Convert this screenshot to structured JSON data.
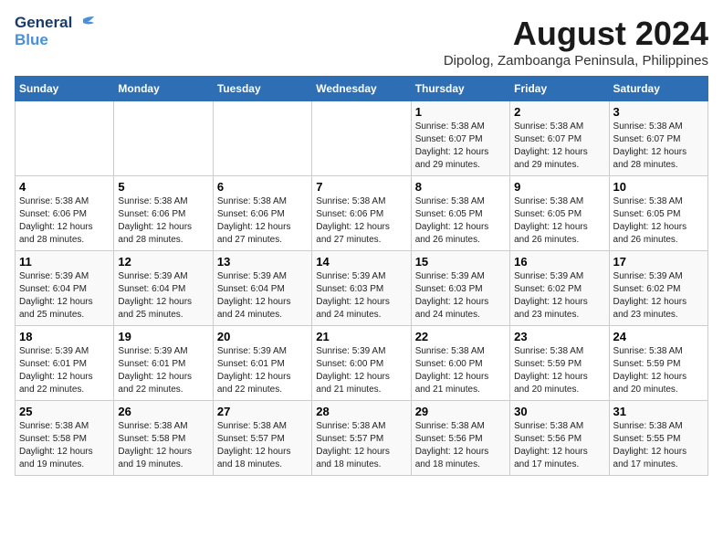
{
  "logo": {
    "line1": "General",
    "line2": "Blue"
  },
  "title": "August 2024",
  "subtitle": "Dipolog, Zamboanga Peninsula, Philippines",
  "headers": [
    "Sunday",
    "Monday",
    "Tuesday",
    "Wednesday",
    "Thursday",
    "Friday",
    "Saturday"
  ],
  "weeks": [
    [
      {
        "day": "",
        "info": ""
      },
      {
        "day": "",
        "info": ""
      },
      {
        "day": "",
        "info": ""
      },
      {
        "day": "",
        "info": ""
      },
      {
        "day": "1",
        "info": "Sunrise: 5:38 AM\nSunset: 6:07 PM\nDaylight: 12 hours\nand 29 minutes."
      },
      {
        "day": "2",
        "info": "Sunrise: 5:38 AM\nSunset: 6:07 PM\nDaylight: 12 hours\nand 29 minutes."
      },
      {
        "day": "3",
        "info": "Sunrise: 5:38 AM\nSunset: 6:07 PM\nDaylight: 12 hours\nand 28 minutes."
      }
    ],
    [
      {
        "day": "4",
        "info": "Sunrise: 5:38 AM\nSunset: 6:06 PM\nDaylight: 12 hours\nand 28 minutes."
      },
      {
        "day": "5",
        "info": "Sunrise: 5:38 AM\nSunset: 6:06 PM\nDaylight: 12 hours\nand 28 minutes."
      },
      {
        "day": "6",
        "info": "Sunrise: 5:38 AM\nSunset: 6:06 PM\nDaylight: 12 hours\nand 27 minutes."
      },
      {
        "day": "7",
        "info": "Sunrise: 5:38 AM\nSunset: 6:06 PM\nDaylight: 12 hours\nand 27 minutes."
      },
      {
        "day": "8",
        "info": "Sunrise: 5:38 AM\nSunset: 6:05 PM\nDaylight: 12 hours\nand 26 minutes."
      },
      {
        "day": "9",
        "info": "Sunrise: 5:38 AM\nSunset: 6:05 PM\nDaylight: 12 hours\nand 26 minutes."
      },
      {
        "day": "10",
        "info": "Sunrise: 5:38 AM\nSunset: 6:05 PM\nDaylight: 12 hours\nand 26 minutes."
      }
    ],
    [
      {
        "day": "11",
        "info": "Sunrise: 5:39 AM\nSunset: 6:04 PM\nDaylight: 12 hours\nand 25 minutes."
      },
      {
        "day": "12",
        "info": "Sunrise: 5:39 AM\nSunset: 6:04 PM\nDaylight: 12 hours\nand 25 minutes."
      },
      {
        "day": "13",
        "info": "Sunrise: 5:39 AM\nSunset: 6:04 PM\nDaylight: 12 hours\nand 24 minutes."
      },
      {
        "day": "14",
        "info": "Sunrise: 5:39 AM\nSunset: 6:03 PM\nDaylight: 12 hours\nand 24 minutes."
      },
      {
        "day": "15",
        "info": "Sunrise: 5:39 AM\nSunset: 6:03 PM\nDaylight: 12 hours\nand 24 minutes."
      },
      {
        "day": "16",
        "info": "Sunrise: 5:39 AM\nSunset: 6:02 PM\nDaylight: 12 hours\nand 23 minutes."
      },
      {
        "day": "17",
        "info": "Sunrise: 5:39 AM\nSunset: 6:02 PM\nDaylight: 12 hours\nand 23 minutes."
      }
    ],
    [
      {
        "day": "18",
        "info": "Sunrise: 5:39 AM\nSunset: 6:01 PM\nDaylight: 12 hours\nand 22 minutes."
      },
      {
        "day": "19",
        "info": "Sunrise: 5:39 AM\nSunset: 6:01 PM\nDaylight: 12 hours\nand 22 minutes."
      },
      {
        "day": "20",
        "info": "Sunrise: 5:39 AM\nSunset: 6:01 PM\nDaylight: 12 hours\nand 22 minutes."
      },
      {
        "day": "21",
        "info": "Sunrise: 5:39 AM\nSunset: 6:00 PM\nDaylight: 12 hours\nand 21 minutes."
      },
      {
        "day": "22",
        "info": "Sunrise: 5:38 AM\nSunset: 6:00 PM\nDaylight: 12 hours\nand 21 minutes."
      },
      {
        "day": "23",
        "info": "Sunrise: 5:38 AM\nSunset: 5:59 PM\nDaylight: 12 hours\nand 20 minutes."
      },
      {
        "day": "24",
        "info": "Sunrise: 5:38 AM\nSunset: 5:59 PM\nDaylight: 12 hours\nand 20 minutes."
      }
    ],
    [
      {
        "day": "25",
        "info": "Sunrise: 5:38 AM\nSunset: 5:58 PM\nDaylight: 12 hours\nand 19 minutes."
      },
      {
        "day": "26",
        "info": "Sunrise: 5:38 AM\nSunset: 5:58 PM\nDaylight: 12 hours\nand 19 minutes."
      },
      {
        "day": "27",
        "info": "Sunrise: 5:38 AM\nSunset: 5:57 PM\nDaylight: 12 hours\nand 18 minutes."
      },
      {
        "day": "28",
        "info": "Sunrise: 5:38 AM\nSunset: 5:57 PM\nDaylight: 12 hours\nand 18 minutes."
      },
      {
        "day": "29",
        "info": "Sunrise: 5:38 AM\nSunset: 5:56 PM\nDaylight: 12 hours\nand 18 minutes."
      },
      {
        "day": "30",
        "info": "Sunrise: 5:38 AM\nSunset: 5:56 PM\nDaylight: 12 hours\nand 17 minutes."
      },
      {
        "day": "31",
        "info": "Sunrise: 5:38 AM\nSunset: 5:55 PM\nDaylight: 12 hours\nand 17 minutes."
      }
    ]
  ]
}
